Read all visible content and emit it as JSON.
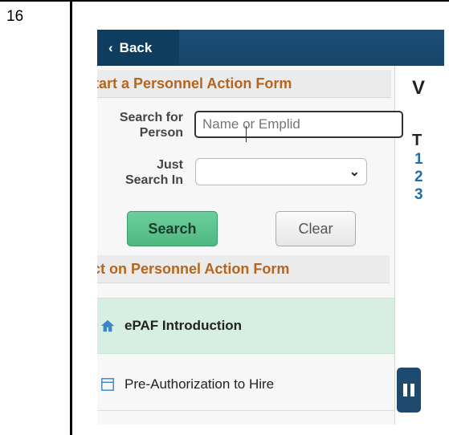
{
  "document": {
    "step_number": "16"
  },
  "app": {
    "back_label": "Back",
    "section1_title": "tart a Personnel Action Form",
    "search_for_label_line1": "Search for",
    "search_for_label_line2": "Person",
    "search_input_placeholder": "Name or Emplid",
    "just_search_in_line1": "Just",
    "just_search_in_line2": "Search In",
    "select_value": "",
    "search_button": "Search",
    "clear_button": "Clear",
    "section2_title": "ct on Personnel Action Form",
    "nav_items": [
      {
        "label": "ePAF Introduction",
        "icon": "home-icon",
        "selected": true
      },
      {
        "label": "Pre-Authorization to Hire",
        "icon": "document-icon",
        "selected": false
      }
    ],
    "right_partial": {
      "heading": "V",
      "line1": "T",
      "n1": "1",
      "n2": "2",
      "n3": "3"
    }
  },
  "colors": {
    "topbar": "#1b4f78",
    "section_header_text": "#b5651d",
    "selected_row": "#d7efe3",
    "search_button": "#5cc08c",
    "link_blue": "#1f6fae"
  }
}
